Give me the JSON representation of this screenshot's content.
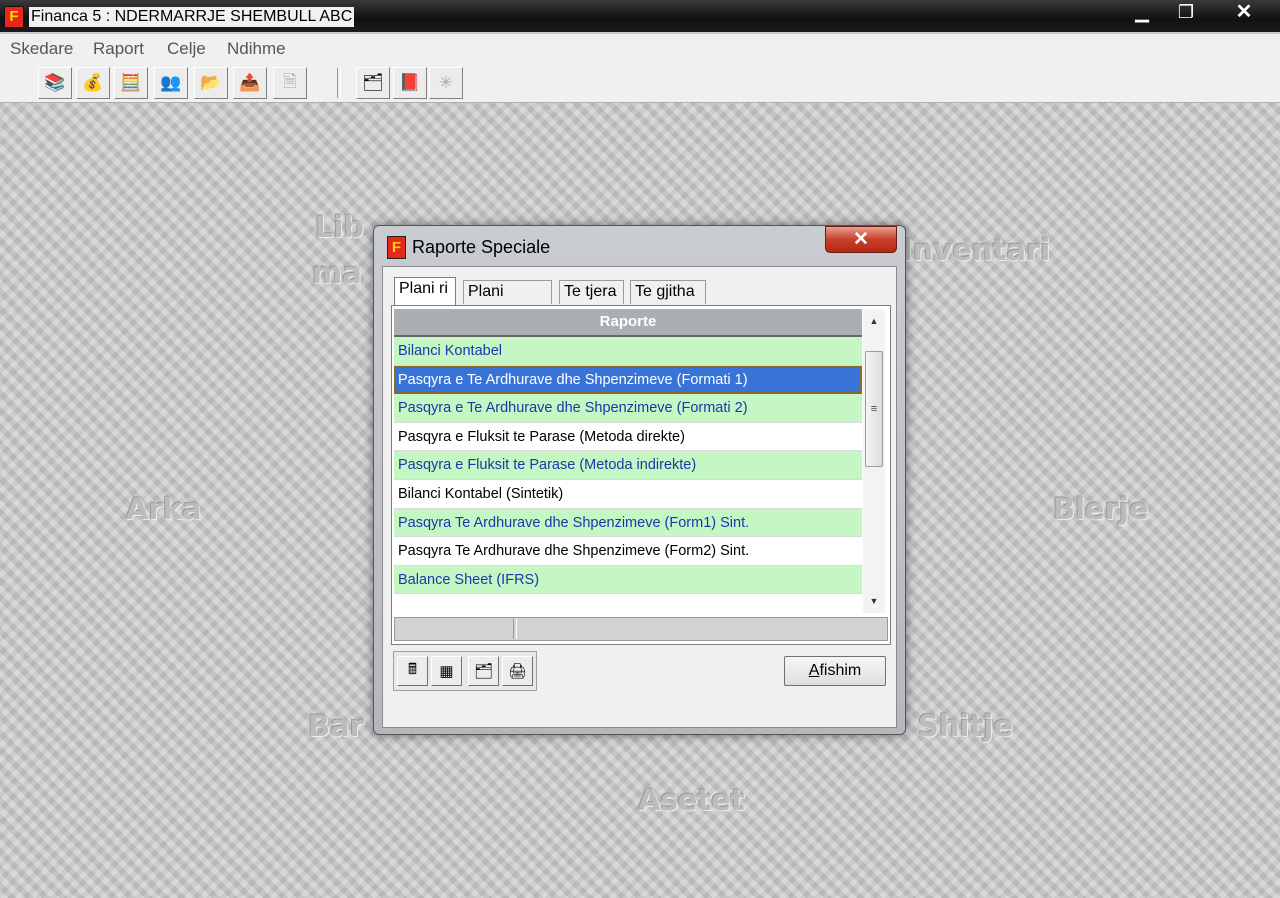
{
  "window": {
    "title": "Financa 5 :  NDERMARRJE SHEMBULL ABC",
    "app_icon_letter": "F",
    "controls": [
      "minimize-icon",
      "restore-icon",
      "close-icon"
    ]
  },
  "menu": [
    "Skedare",
    "Raport",
    "Celje",
    "Ndihme"
  ],
  "toolbar": {
    "buttons": [
      {
        "name": "books-icon",
        "glyph": "📚"
      },
      {
        "name": "coins-icon",
        "glyph": "💰"
      },
      {
        "name": "calculator-coins-icon",
        "glyph": "🧮"
      },
      {
        "name": "people-icon",
        "glyph": "👥"
      },
      {
        "name": "folder-open-icon",
        "glyph": "📂"
      },
      {
        "name": "folder-export-icon",
        "glyph": "📤"
      },
      {
        "name": "document-disabled-icon",
        "glyph": "🗎"
      },
      {
        "name": "report-calculator-icon",
        "glyph": "🗂"
      },
      {
        "name": "book-icon",
        "glyph": "📕"
      },
      {
        "name": "settings-disabled-icon",
        "glyph": "✳"
      }
    ]
  },
  "desktop_modules": [
    "Lib",
    "ma",
    "Inventari",
    "Arka",
    "Blerje",
    "Bar",
    "Shitje",
    "Asetet"
  ],
  "dialog": {
    "title": "Raporte Speciale",
    "icon_letter": "F",
    "close_glyph": "✕",
    "tabs": [
      "Plani ri",
      "Plani vjeter",
      "Te tjera",
      "Te gjitha"
    ],
    "active_tab": "Plani ri",
    "grid_header": "Raporte",
    "rows": [
      {
        "label": "Bilanci Kontabel",
        "style": "green"
      },
      {
        "label": "Pasqyra e Te Ardhurave dhe Shpenzimeve (Formati 1)",
        "style": "selected"
      },
      {
        "label": "Pasqyra e Te Ardhurave dhe Shpenzimeve (Formati 2)",
        "style": "green"
      },
      {
        "label": "Pasqyra e Fluksit te Parase (Metoda direkte)",
        "style": "white"
      },
      {
        "label": "Pasqyra e Fluksit te Parase (Metoda indirekte)",
        "style": "green"
      },
      {
        "label": "Bilanci Kontabel (Sintetik)",
        "style": "white"
      },
      {
        "label": "Pasqyra Te Ardhurave dhe Shpenzimeve (Form1) Sint.",
        "style": "green"
      },
      {
        "label": "Pasqyra Te Ardhurave dhe Shpenzimeve (Form2) Sint.",
        "style": "white"
      },
      {
        "label": "Balance Sheet  (IFRS)",
        "style": "green"
      }
    ],
    "bottom_tools": [
      {
        "name": "calculator-icon",
        "glyph": "🖩"
      },
      {
        "name": "grid-icon",
        "glyph": "▦"
      },
      {
        "name": "report-calculator-icon",
        "glyph": "🗂"
      },
      {
        "name": "print-export-icon",
        "glyph": "🖨"
      }
    ],
    "afishim_label_prefix": "A",
    "afishim_label_rest": "fishim"
  }
}
